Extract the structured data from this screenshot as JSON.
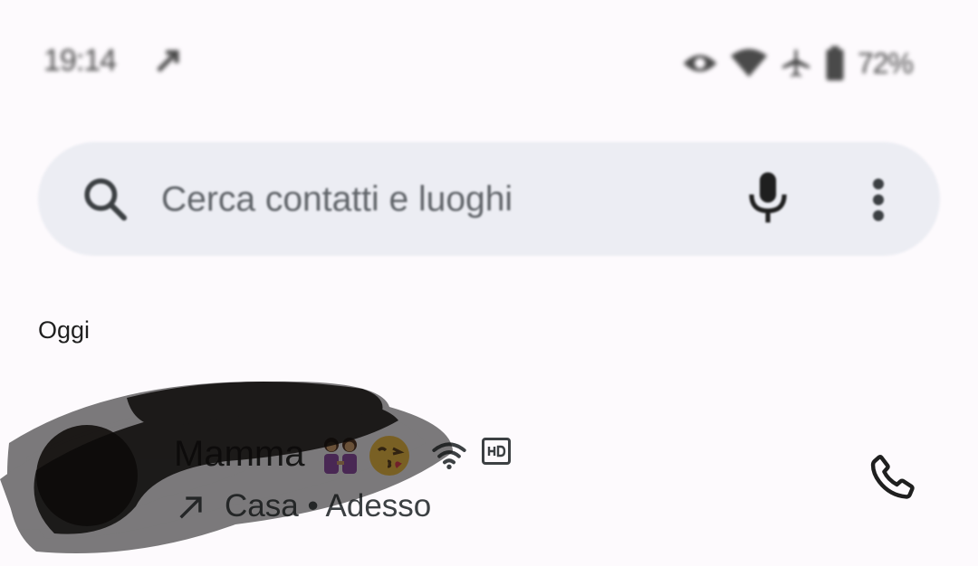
{
  "status_bar": {
    "time": "19:14",
    "battery": "72%",
    "icons": [
      "missed-call-icon",
      "eye-icon",
      "wifi-icon",
      "airplane-icon",
      "battery-icon"
    ]
  },
  "search": {
    "placeholder": "Cerca contatti e luoghi",
    "icons": [
      "search-icon",
      "microphone-icon",
      "more-vert-icon"
    ]
  },
  "recents": {
    "section_label": "Oggi",
    "items": [
      {
        "name": "Mamma",
        "emoji": [
          "women-holding-hands-emoji",
          "kissing-face-emoji"
        ],
        "call_type": "outgoing",
        "location": "Casa",
        "separator": "•",
        "time": "Adesso",
        "badges": [
          "wifi-call-icon",
          "hd-icon"
        ],
        "action_icon": "phone-icon"
      }
    ]
  },
  "colors": {
    "background": "#fdfafd",
    "search_bg": "#ecedf3",
    "text_primary": "#1f1f1f",
    "text_secondary": "#3c4043"
  }
}
